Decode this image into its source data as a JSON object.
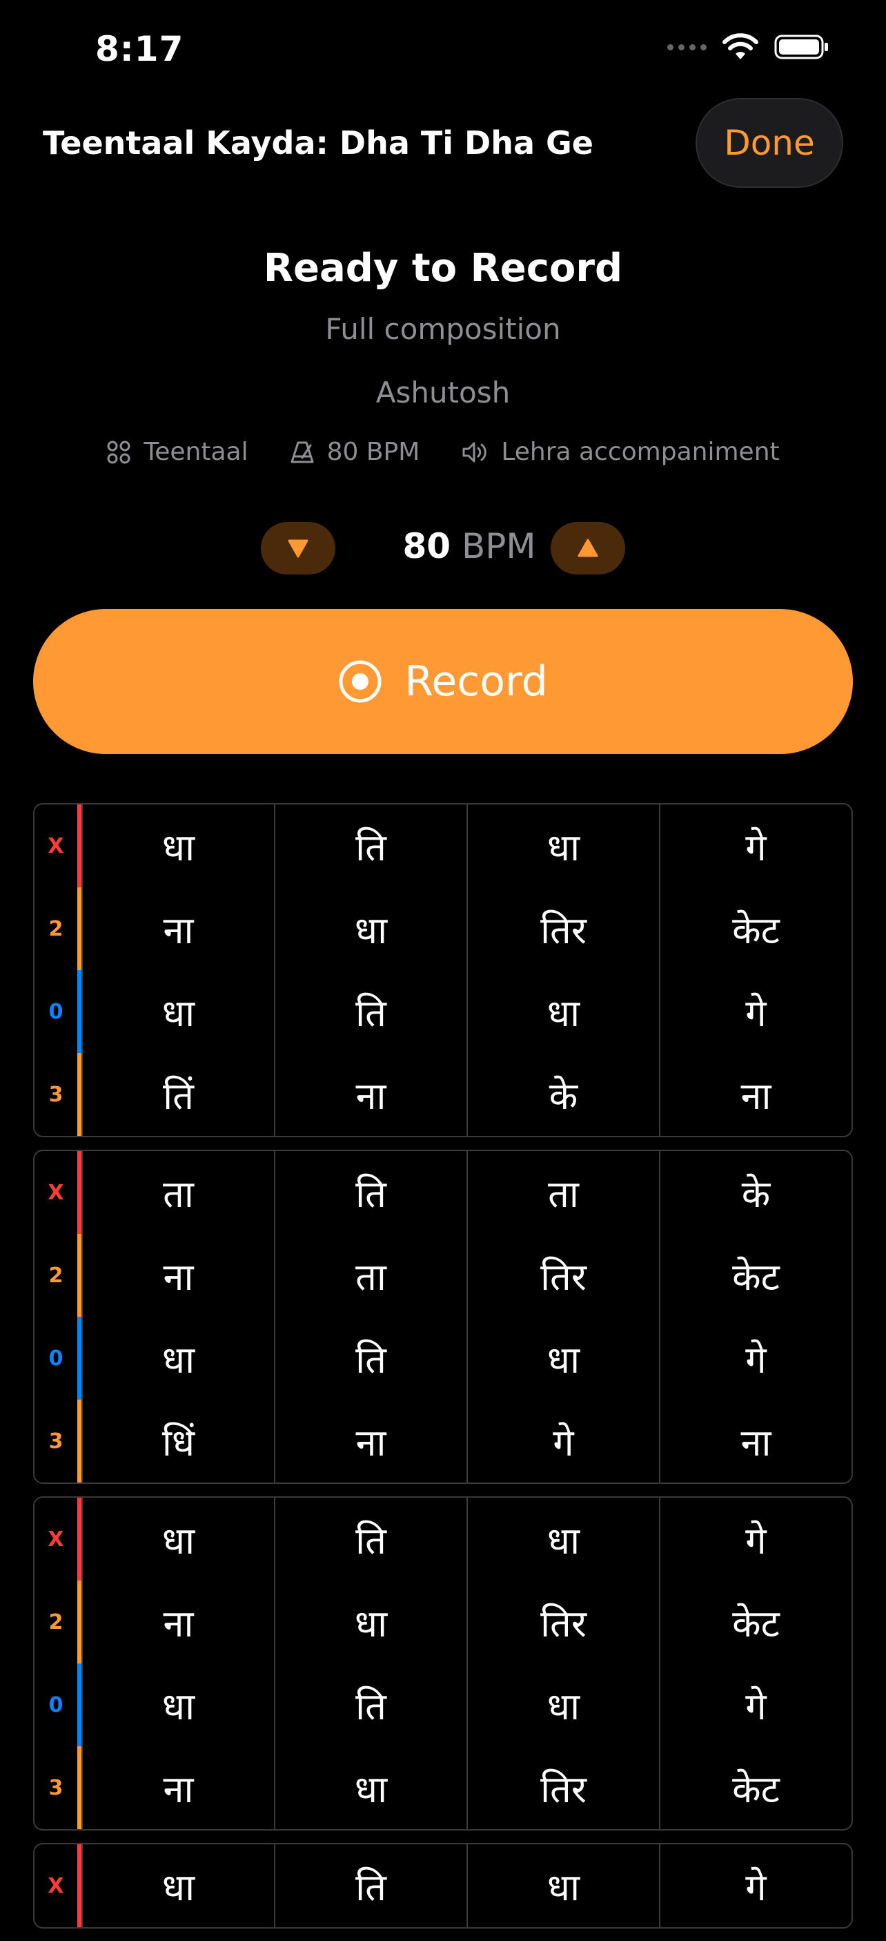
{
  "status": {
    "time": "8:17"
  },
  "nav": {
    "title": "Teentaal Kayda: Dha Ti Dha Ge",
    "done_label": "Done"
  },
  "session": {
    "heading": "Ready to Record",
    "subtitle": "Full composition",
    "author": "Ashutosh",
    "meta": {
      "taal": "Teentaal",
      "tempo": "80 BPM",
      "accompaniment": "Lehra accompaniment"
    }
  },
  "tempo": {
    "value": "80",
    "unit": "BPM"
  },
  "record": {
    "label": "Record"
  },
  "colors": {
    "accent": "#ff9933",
    "sam": "#ff3b3b",
    "taali": "#ff9933",
    "khali": "#0a84ff"
  },
  "blocks": [
    {
      "rows": [
        {
          "marker": "X",
          "type": "sam",
          "bols": [
            "धा",
            "ति",
            "धा",
            "गे"
          ]
        },
        {
          "marker": "2",
          "type": "taali",
          "bols": [
            "ना",
            "धा",
            "तिर",
            "केट"
          ]
        },
        {
          "marker": "0",
          "type": "khali",
          "bols": [
            "धा",
            "ति",
            "धा",
            "गे"
          ]
        },
        {
          "marker": "3",
          "type": "taali",
          "bols": [
            "तिं",
            "ना",
            "के",
            "ना"
          ]
        }
      ]
    },
    {
      "rows": [
        {
          "marker": "X",
          "type": "sam",
          "bols": [
            "ता",
            "ति",
            "ता",
            "के"
          ]
        },
        {
          "marker": "2",
          "type": "taali",
          "bols": [
            "ना",
            "ता",
            "तिर",
            "केट"
          ]
        },
        {
          "marker": "0",
          "type": "khali",
          "bols": [
            "धा",
            "ति",
            "धा",
            "गे"
          ]
        },
        {
          "marker": "3",
          "type": "taali",
          "bols": [
            "धिं",
            "ना",
            "गे",
            "ना"
          ]
        }
      ]
    },
    {
      "rows": [
        {
          "marker": "X",
          "type": "sam",
          "bols": [
            "धा",
            "ति",
            "धा",
            "गे"
          ]
        },
        {
          "marker": "2",
          "type": "taali",
          "bols": [
            "ना",
            "धा",
            "तिर",
            "केट"
          ]
        },
        {
          "marker": "0",
          "type": "khali",
          "bols": [
            "धा",
            "ति",
            "धा",
            "गे"
          ]
        },
        {
          "marker": "3",
          "type": "taali",
          "bols": [
            "ना",
            "धा",
            "तिर",
            "केट"
          ]
        }
      ]
    },
    {
      "rows": [
        {
          "marker": "X",
          "type": "sam",
          "bols": [
            "धा",
            "ति",
            "धा",
            "गे"
          ]
        }
      ]
    }
  ]
}
